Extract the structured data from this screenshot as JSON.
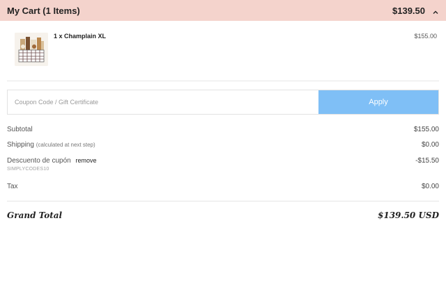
{
  "header": {
    "title": "My Cart (1 Items)",
    "total": "$139.50",
    "toggle_icon": "chevron-up-icon"
  },
  "item": {
    "name": "1 x Champlain XL",
    "price": "$155.00",
    "image_icon": "gift-basket-image"
  },
  "coupon": {
    "placeholder": "Coupon Code / Gift Certificate",
    "value": "",
    "apply_label": "Apply"
  },
  "summary": {
    "subtotal": {
      "label": "Subtotal",
      "value": "$155.00"
    },
    "shipping": {
      "label": "Shipping",
      "note": "(calculated at next step)",
      "value": "$0.00"
    },
    "discount": {
      "label": "Descuento de cupón",
      "remove_label": "remove",
      "code": "SIMPLYCODES10",
      "value": "-$15.50"
    },
    "tax": {
      "label": "Tax",
      "value": "$0.00"
    }
  },
  "grand_total": {
    "label": "Grand Total",
    "value": "$139.50 USD"
  },
  "colors": {
    "header_bg": "#f4d3cc",
    "apply_bg": "#7fbff6"
  }
}
